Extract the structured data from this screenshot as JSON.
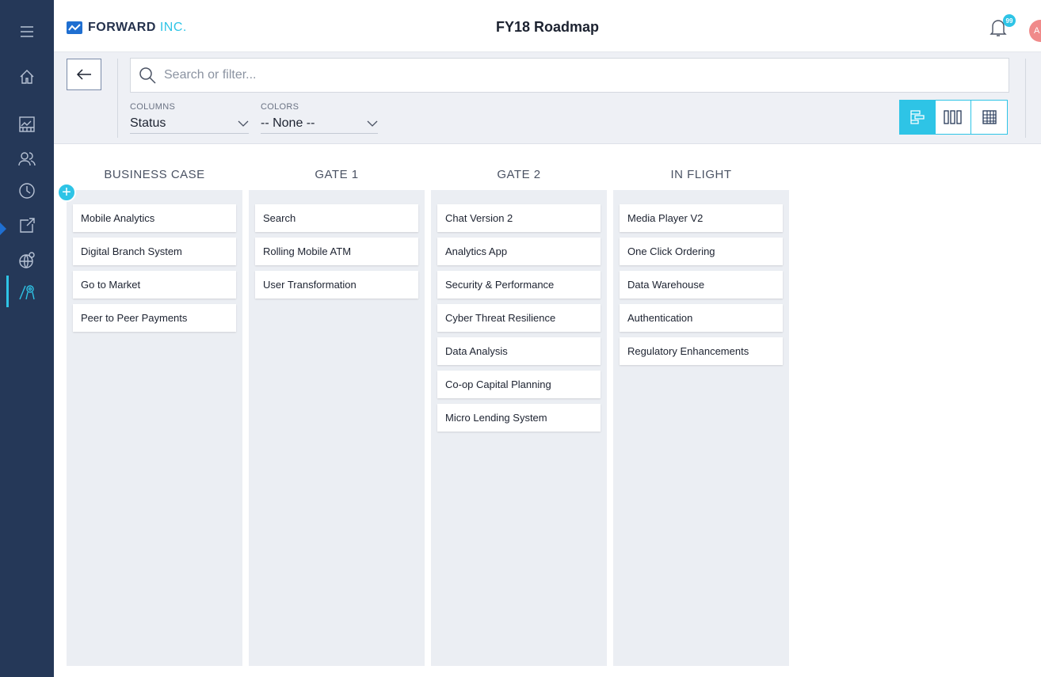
{
  "app": {
    "logo_text_bold": "FORWARD",
    "logo_text_light": "INC.",
    "page_title": "FY18 Roadmap",
    "notifications_count": "99",
    "avatar_initial": "A"
  },
  "sidebar": {
    "items": [
      {
        "icon": "menu-icon"
      },
      {
        "icon": "home-icon"
      },
      {
        "icon": "dashboard-icon"
      },
      {
        "icon": "people-icon"
      },
      {
        "icon": "clock-icon"
      },
      {
        "icon": "external-link-icon"
      },
      {
        "icon": "globe-icon"
      },
      {
        "icon": "roadmap-icon",
        "active": true
      }
    ]
  },
  "filters": {
    "search_placeholder": "Search or filter...",
    "columns_label": "COLUMNS",
    "columns_value": "Status",
    "colors_label": "COLORS",
    "colors_value": "-- None --"
  },
  "view_modes": [
    "timeline-view",
    "board-view",
    "grid-view"
  ],
  "colors": {
    "sidebar_bg": "#253858",
    "accent": "#2ec4e6",
    "column_bg": "#ebeef3"
  },
  "board": {
    "columns": [
      {
        "title": "BUSINESS CASE",
        "cards": [
          "Mobile Analytics",
          "Digital Branch System",
          "Go to Market",
          "Peer to Peer Payments"
        ]
      },
      {
        "title": "GATE 1",
        "cards": [
          "Search",
          "Rolling Mobile ATM",
          "User Transformation"
        ]
      },
      {
        "title": "GATE 2",
        "cards": [
          "Chat Version 2",
          "Analytics App",
          "Security & Performance",
          "Cyber Threat Resilience",
          "Data Analysis",
          "Co-op Capital Planning",
          "Micro Lending System"
        ]
      },
      {
        "title": "IN FLIGHT",
        "cards": [
          "Media Player V2",
          "One Click Ordering",
          "Data Warehouse",
          "Authentication",
          "Regulatory Enhancements"
        ]
      }
    ]
  }
}
